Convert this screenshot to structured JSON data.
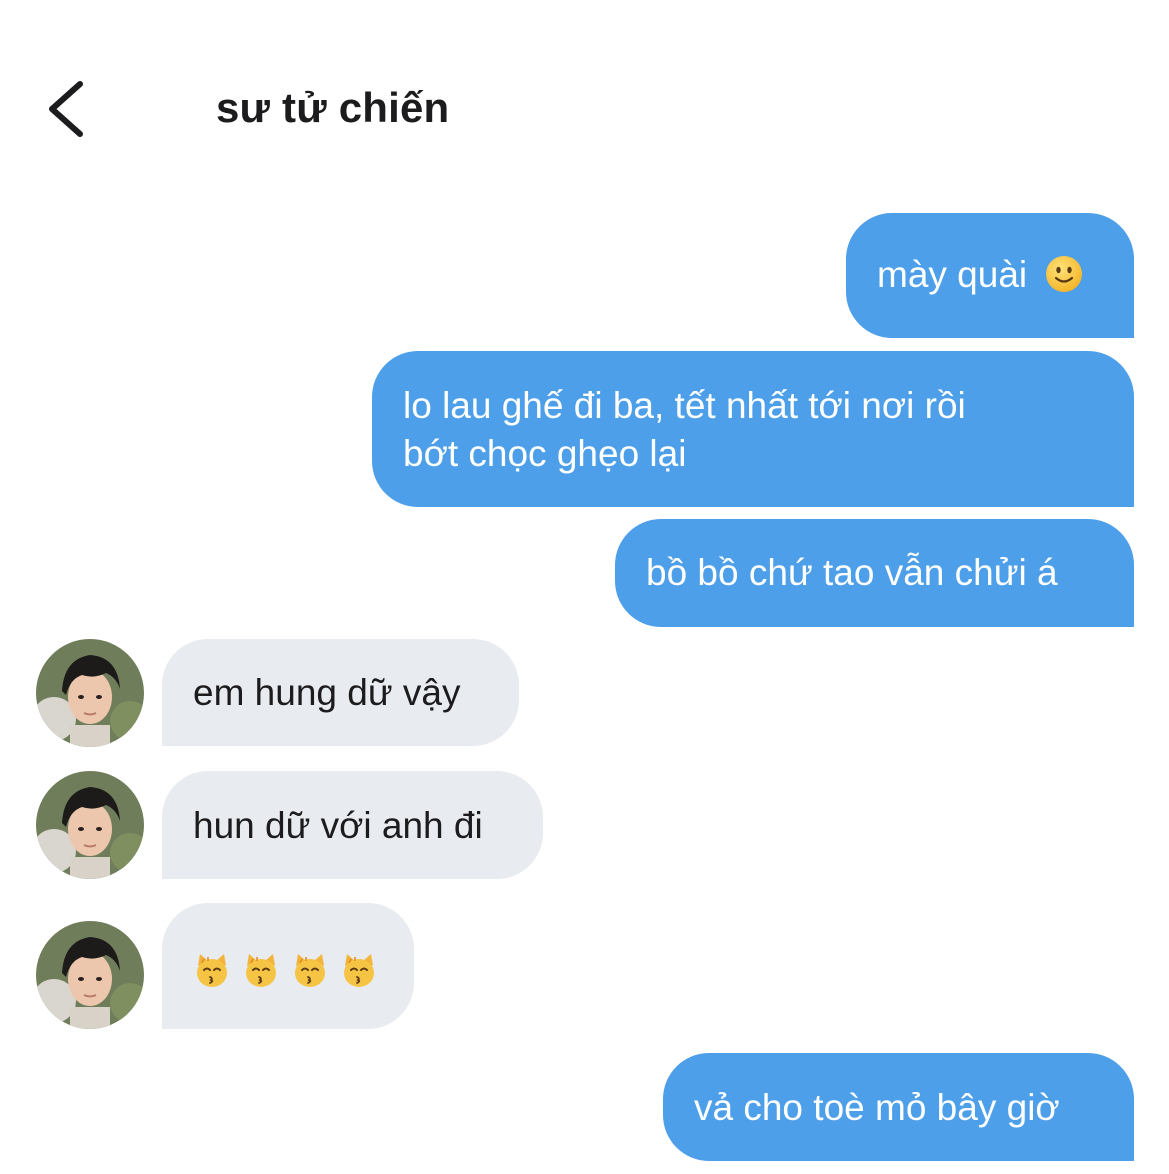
{
  "header": {
    "title": "sư tử chiến",
    "back_icon": "chevron-left-icon"
  },
  "messages": [
    {
      "side": "out",
      "text": "mày quài",
      "emoji": "slightly-smiling-face"
    },
    {
      "side": "out",
      "text": "lo lau ghế đi ba, tết nhất tới nơi rồi",
      "text2": "bớt chọc ghẹo lại"
    },
    {
      "side": "out",
      "text": "bồ bồ chứ tao vẫn chửi á"
    },
    {
      "side": "in",
      "text": "em hung dữ vậy"
    },
    {
      "side": "in",
      "text": "hun dữ với anh đi"
    },
    {
      "side": "in",
      "emoji": "kissing-cat-face",
      "emoji_count": 4
    },
    {
      "side": "out",
      "text": "vả cho toè mỏ bây giờ"
    }
  ],
  "colors": {
    "outgoing_bubble": "#4e9fe9",
    "incoming_bubble": "#e8ebef",
    "title_text": "#1c1c1e"
  }
}
